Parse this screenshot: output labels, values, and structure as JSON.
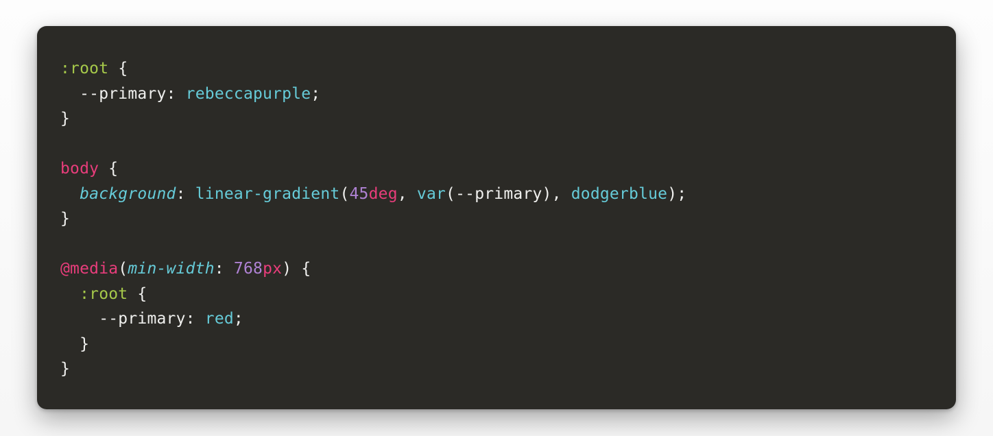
{
  "code": {
    "tokens": [
      {
        "cls": "tok-selector",
        "t": ":root"
      },
      {
        "cls": "tok-plain",
        "t": " "
      },
      {
        "cls": "tok-punct",
        "t": "{"
      },
      {
        "cls": "nl"
      },
      {
        "cls": "tok-plain",
        "t": "  "
      },
      {
        "cls": "tok-var",
        "t": "--primary"
      },
      {
        "cls": "tok-punct",
        "t": ":"
      },
      {
        "cls": "tok-plain",
        "t": " "
      },
      {
        "cls": "tok-ident",
        "t": "rebeccapurple"
      },
      {
        "cls": "tok-punct",
        "t": ";"
      },
      {
        "cls": "nl"
      },
      {
        "cls": "tok-punct",
        "t": "}"
      },
      {
        "cls": "nl"
      },
      {
        "cls": "nl"
      },
      {
        "cls": "tok-tag",
        "t": "body"
      },
      {
        "cls": "tok-plain",
        "t": " "
      },
      {
        "cls": "tok-punct",
        "t": "{"
      },
      {
        "cls": "nl"
      },
      {
        "cls": "tok-plain",
        "t": "  "
      },
      {
        "cls": "tok-prop",
        "t": "background"
      },
      {
        "cls": "tok-punct",
        "t": ":"
      },
      {
        "cls": "tok-plain",
        "t": " "
      },
      {
        "cls": "tok-ident",
        "t": "linear-gradient"
      },
      {
        "cls": "tok-punct",
        "t": "("
      },
      {
        "cls": "tok-num",
        "t": "45"
      },
      {
        "cls": "tok-unit",
        "t": "deg"
      },
      {
        "cls": "tok-punct",
        "t": ","
      },
      {
        "cls": "tok-plain",
        "t": " "
      },
      {
        "cls": "tok-ident",
        "t": "var"
      },
      {
        "cls": "tok-punct",
        "t": "("
      },
      {
        "cls": "tok-plain",
        "t": "--primary"
      },
      {
        "cls": "tok-punct",
        "t": ")"
      },
      {
        "cls": "tok-punct",
        "t": ","
      },
      {
        "cls": "tok-plain",
        "t": " "
      },
      {
        "cls": "tok-ident",
        "t": "dodgerblue"
      },
      {
        "cls": "tok-punct",
        "t": ")"
      },
      {
        "cls": "tok-punct",
        "t": ";"
      },
      {
        "cls": "nl"
      },
      {
        "cls": "tok-punct",
        "t": "}"
      },
      {
        "cls": "nl"
      },
      {
        "cls": "nl"
      },
      {
        "cls": "tok-tag",
        "t": "@media"
      },
      {
        "cls": "tok-punct",
        "t": "("
      },
      {
        "cls": "tok-prop",
        "t": "min-width"
      },
      {
        "cls": "tok-punct",
        "t": ":"
      },
      {
        "cls": "tok-plain",
        "t": " "
      },
      {
        "cls": "tok-num",
        "t": "768"
      },
      {
        "cls": "tok-unit",
        "t": "px"
      },
      {
        "cls": "tok-punct",
        "t": ")"
      },
      {
        "cls": "tok-plain",
        "t": " "
      },
      {
        "cls": "tok-punct",
        "t": "{"
      },
      {
        "cls": "nl"
      },
      {
        "cls": "tok-plain",
        "t": "  "
      },
      {
        "cls": "tok-selector",
        "t": ":root"
      },
      {
        "cls": "tok-plain",
        "t": " "
      },
      {
        "cls": "tok-punct",
        "t": "{"
      },
      {
        "cls": "nl"
      },
      {
        "cls": "tok-plain",
        "t": "    "
      },
      {
        "cls": "tok-var",
        "t": "--primary"
      },
      {
        "cls": "tok-punct",
        "t": ":"
      },
      {
        "cls": "tok-plain",
        "t": " "
      },
      {
        "cls": "tok-ident",
        "t": "red"
      },
      {
        "cls": "tok-punct",
        "t": ";"
      },
      {
        "cls": "nl"
      },
      {
        "cls": "tok-plain",
        "t": "  "
      },
      {
        "cls": "tok-punct",
        "t": "}"
      },
      {
        "cls": "nl"
      },
      {
        "cls": "tok-punct",
        "t": "}"
      }
    ]
  }
}
